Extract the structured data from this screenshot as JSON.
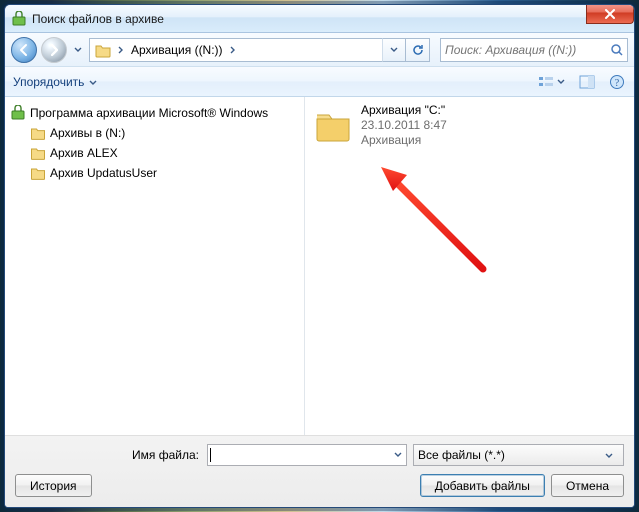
{
  "window": {
    "title": "Поиск файлов в архиве"
  },
  "nav": {
    "breadcrumb_label": "Архивация ((N:))",
    "search_placeholder": "Поиск: Архивация ((N:))"
  },
  "toolbar": {
    "organize_label": "Упорядочить"
  },
  "tree": {
    "root_label": "Программа архивации Microsoft® Windows",
    "children": [
      {
        "label": "Архивы в (N:)"
      },
      {
        "label": "Архив ALEX"
      },
      {
        "label": "Архив UpdatusUser"
      }
    ]
  },
  "content": {
    "item": {
      "name": "Архивация \"C:\"",
      "date": "23.10.2011 8:47",
      "type": "Архивация"
    }
  },
  "bottom": {
    "filename_label": "Имя файла:",
    "filename_value": "",
    "filter_label": "Все файлы (*.*)",
    "history_label": "История",
    "add_label": "Добавить файлы",
    "cancel_label": "Отмена"
  },
  "icons": {
    "archive_app": "archive-app-icon",
    "folder": "folder-icon"
  },
  "colors": {
    "accent_blue": "#14407c",
    "link_blue": "#1a3e78",
    "close_red": "#cf3b23",
    "folder_yellow": "#f4d478"
  }
}
